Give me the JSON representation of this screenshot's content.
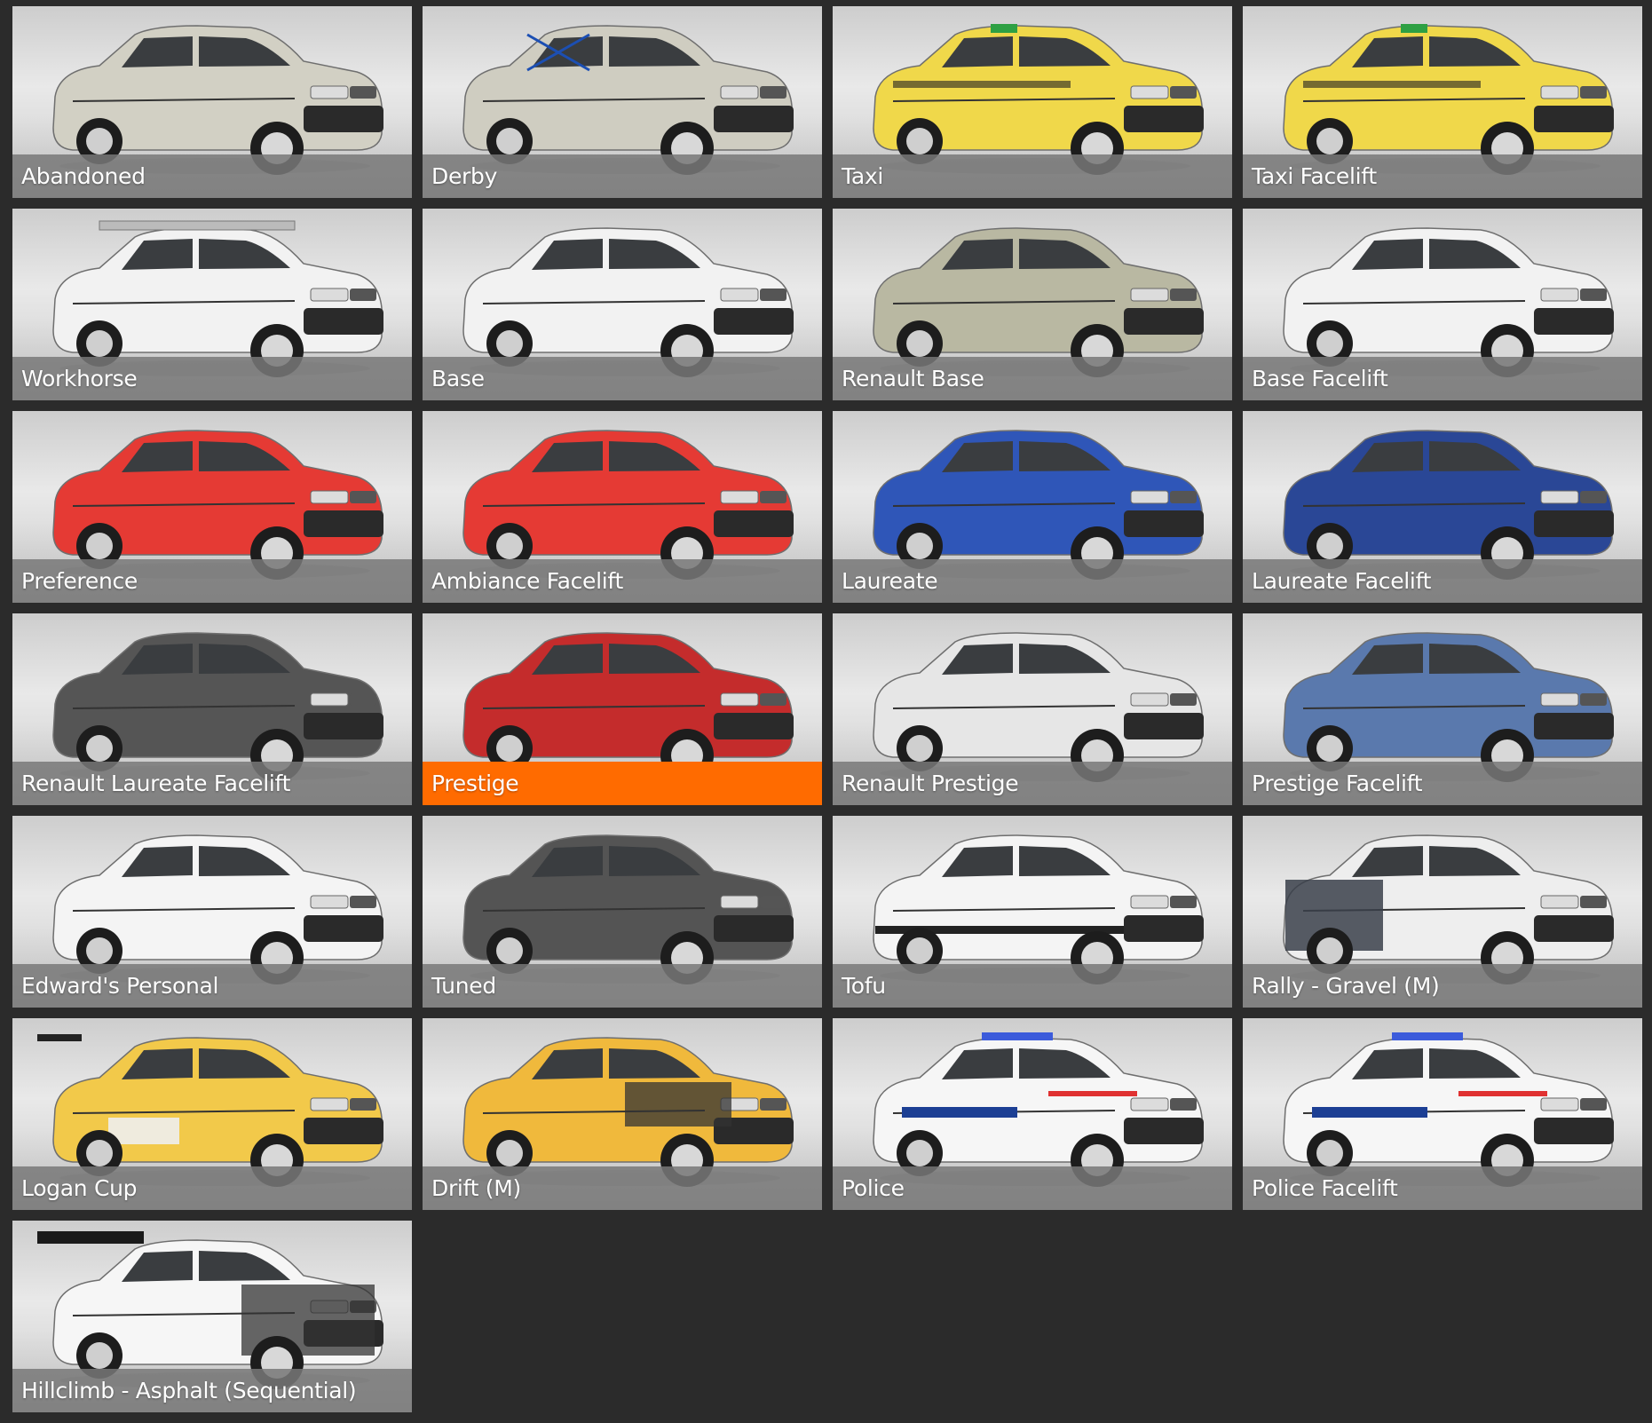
{
  "selected_index": 13,
  "accent_color": "#ff6b00",
  "configurations": [
    {
      "label": "Abandoned",
      "body_color": "#d2d0c4",
      "trim": "rusty"
    },
    {
      "label": "Derby",
      "body_color": "#cfcdc1",
      "trim": "rollcage"
    },
    {
      "label": "Taxi",
      "body_color": "#f0d84a",
      "trim": "taxi"
    },
    {
      "label": "Taxi Facelift",
      "body_color": "#f0d84a",
      "trim": "taxi"
    },
    {
      "label": "Workhorse",
      "body_color": "#f2f2f2",
      "trim": "roofrack"
    },
    {
      "label": "Base",
      "body_color": "#f2f2f2",
      "trim": "plain"
    },
    {
      "label": "Renault Base",
      "body_color": "#b9b8a2",
      "trim": "plain"
    },
    {
      "label": "Base Facelift",
      "body_color": "#f2f2f2",
      "trim": "plain"
    },
    {
      "label": "Preference",
      "body_color": "#e53a34",
      "trim": "plain"
    },
    {
      "label": "Ambiance Facelift",
      "body_color": "#e53a34",
      "trim": "plain"
    },
    {
      "label": "Laureate",
      "body_color": "#2f56b8",
      "trim": "plain"
    },
    {
      "label": "Laureate Facelift",
      "body_color": "#2a4796",
      "trim": "plain"
    },
    {
      "label": "Renault Laureate Facelift",
      "body_color": "#555555",
      "trim": "plain"
    },
    {
      "label": "Prestige",
      "body_color": "#c42c2c",
      "trim": "plain"
    },
    {
      "label": "Renault Prestige",
      "body_color": "#e6e6e6",
      "trim": "plain"
    },
    {
      "label": "Prestige Facelift",
      "body_color": "#5a79ad",
      "trim": "plain"
    },
    {
      "label": "Edward's Personal",
      "body_color": "#f4f4f4",
      "trim": "plain"
    },
    {
      "label": "Tuned",
      "body_color": "#545454",
      "trim": "plain"
    },
    {
      "label": "Tofu",
      "body_color": "#f4f4f4",
      "trim": "tofu"
    },
    {
      "label": "Rally - Gravel (M)",
      "body_color": "#eeeeee",
      "trim": "rally"
    },
    {
      "label": "Logan Cup",
      "body_color": "#f2c94a",
      "trim": "race"
    },
    {
      "label": "Drift (M)",
      "body_color": "#f0b93c",
      "trim": "drift"
    },
    {
      "label": "Police",
      "body_color": "#f6f6f6",
      "trim": "police"
    },
    {
      "label": "Police Facelift",
      "body_color": "#f6f6f6",
      "trim": "police"
    },
    {
      "label": "Hillclimb - Asphalt (Sequential)",
      "body_color": "#f6f6f6",
      "trim": "hillclimb"
    }
  ]
}
